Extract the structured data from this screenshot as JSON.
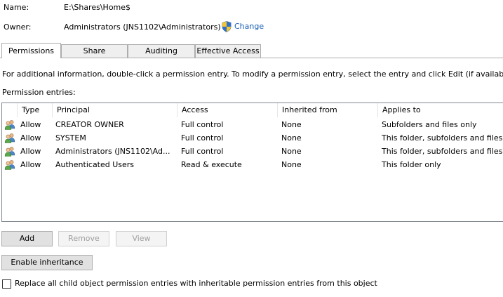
{
  "header": {
    "name_label": "Name:",
    "name_value": "E:\\Shares\\Home$",
    "owner_label": "Owner:",
    "owner_value": "Administrators (JNS1102\\Administrators)",
    "change_label": "Change"
  },
  "tabs": [
    {
      "label": "Permissions",
      "active": true
    },
    {
      "label": "Share",
      "active": false
    },
    {
      "label": "Auditing",
      "active": false
    },
    {
      "label": "Effective Access",
      "active": false
    }
  ],
  "info_text": "For additional information, double-click a permission entry. To modify a permission entry, select the entry and click Edit (if available).",
  "entries_label": "Permission entries:",
  "table": {
    "columns": [
      "Type",
      "Principal",
      "Access",
      "Inherited from",
      "Applies to"
    ],
    "rows": [
      [
        "Allow",
        "CREATOR OWNER",
        "Full control",
        "None",
        "Subfolders and files only"
      ],
      [
        "Allow",
        "SYSTEM",
        "Full control",
        "None",
        "This folder, subfolders and files"
      ],
      [
        "Allow",
        "Administrators (JNS1102\\Ad...",
        "Full control",
        "None",
        "This folder, subfolders and files"
      ],
      [
        "Allow",
        "Authenticated Users",
        "Read & execute",
        "None",
        "This folder only"
      ]
    ]
  },
  "buttons": {
    "add": "Add",
    "remove": "Remove",
    "view": "View",
    "enable_inheritance": "Enable inheritance"
  },
  "replace_checkbox": {
    "label": "Replace all child object permission entries with inheritable permission entries from this object",
    "checked": false
  },
  "colors": {
    "link": "#1a5fb4",
    "tab_inactive": "#efefef",
    "button": "#e1e1e1"
  },
  "icons": {
    "owner_change": "uac-shield-icon",
    "entry": "users-group-icon"
  }
}
